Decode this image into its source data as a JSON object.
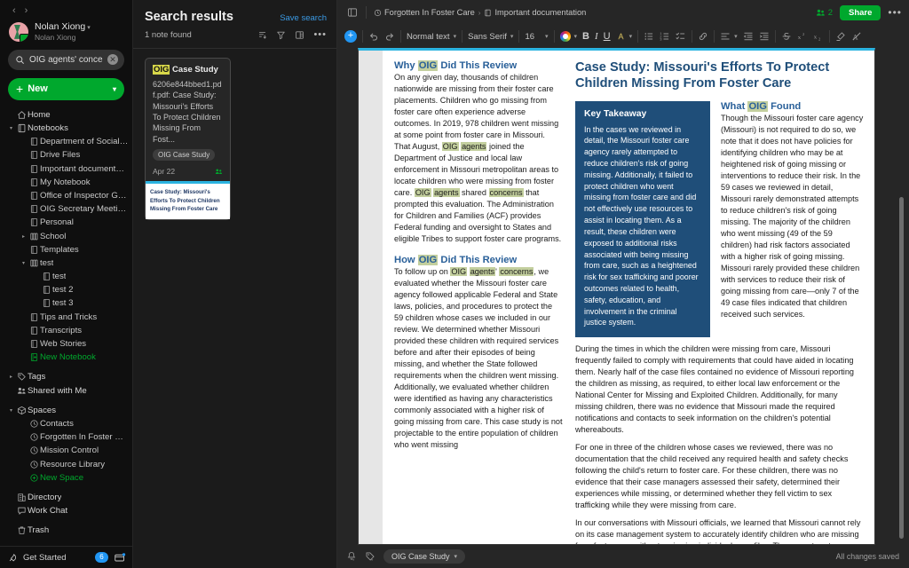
{
  "sidebar": {
    "nav_back": "‹",
    "nav_forward": "›",
    "account": {
      "name": "Nolan Xiong",
      "subname": "Nolan Xiong"
    },
    "search": {
      "value": "OIG agents' concerns",
      "placeholder": "Search"
    },
    "new_button": "New",
    "items": [
      {
        "label": "Home",
        "icon": "home-icon",
        "level": 0,
        "twisty": "",
        "green": false
      },
      {
        "label": "Notebooks",
        "icon": "notebook-icon",
        "level": 0,
        "twisty": "▾",
        "green": false
      },
      {
        "label": "Department of Social Se...",
        "icon": "note-icon",
        "level": 1,
        "twisty": "",
        "green": false
      },
      {
        "label": "Drive Files",
        "icon": "note-icon",
        "level": 1,
        "twisty": "",
        "green": false
      },
      {
        "label": "Important documentation",
        "icon": "note-icon",
        "level": 1,
        "twisty": "",
        "green": false
      },
      {
        "label": "My Notebook",
        "icon": "note-icon",
        "level": 1,
        "twisty": "",
        "green": false
      },
      {
        "label": "Office of Inspector Gene...",
        "icon": "note-icon",
        "level": 1,
        "twisty": "",
        "green": false
      },
      {
        "label": "OIG Secretary Meeting 4...",
        "icon": "note-icon",
        "level": 1,
        "twisty": "",
        "green": false
      },
      {
        "label": "Personal",
        "icon": "note-icon",
        "level": 1,
        "twisty": "",
        "green": false
      },
      {
        "label": "School",
        "icon": "stack-icon",
        "level": 1,
        "twisty": "▸",
        "green": false
      },
      {
        "label": "Templates",
        "icon": "note-icon",
        "level": 1,
        "twisty": "",
        "green": false
      },
      {
        "label": "test",
        "icon": "stack-icon",
        "level": 1,
        "twisty": "▾",
        "green": false
      },
      {
        "label": "test",
        "icon": "note-icon",
        "level": 2,
        "twisty": "",
        "green": false
      },
      {
        "label": "test 2",
        "icon": "note-icon",
        "level": 2,
        "twisty": "",
        "green": false
      },
      {
        "label": "test 3",
        "icon": "note-icon",
        "level": 2,
        "twisty": "",
        "green": false
      },
      {
        "label": "Tips and Tricks",
        "icon": "note-icon",
        "level": 1,
        "twisty": "",
        "green": false
      },
      {
        "label": "Transcripts",
        "icon": "note-icon",
        "level": 1,
        "twisty": "",
        "green": false
      },
      {
        "label": "Web Stories",
        "icon": "note-icon",
        "level": 1,
        "twisty": "",
        "green": false
      },
      {
        "label": "New Notebook",
        "icon": "new-notebook-icon",
        "level": 1,
        "twisty": "",
        "green": true
      },
      {
        "label": "",
        "icon": "spacer",
        "level": 0,
        "twisty": "",
        "green": false
      },
      {
        "label": "Tags",
        "icon": "tag-icon",
        "level": 0,
        "twisty": "▸",
        "green": false
      },
      {
        "label": "Shared with Me",
        "icon": "shared-icon",
        "level": 0,
        "twisty": "",
        "green": false
      },
      {
        "label": "",
        "icon": "spacer",
        "level": 0,
        "twisty": "",
        "green": false
      },
      {
        "label": "Spaces",
        "icon": "spaces-icon",
        "level": 0,
        "twisty": "▾",
        "green": false
      },
      {
        "label": "Contacts",
        "icon": "space-icon",
        "level": 1,
        "twisty": "",
        "green": false
      },
      {
        "label": "Forgotten In Foster Care",
        "icon": "space-icon",
        "level": 1,
        "twisty": "",
        "green": false
      },
      {
        "label": "Mission Control",
        "icon": "space-icon",
        "level": 1,
        "twisty": "",
        "green": false
      },
      {
        "label": "Resource Library",
        "icon": "space-icon",
        "level": 1,
        "twisty": "",
        "green": false
      },
      {
        "label": "New Space",
        "icon": "new-space-icon",
        "level": 1,
        "twisty": "",
        "green": true
      },
      {
        "label": "",
        "icon": "spacer",
        "level": 0,
        "twisty": "",
        "green": false
      },
      {
        "label": "Directory",
        "icon": "directory-icon",
        "level": 0,
        "twisty": "",
        "green": false
      },
      {
        "label": "Work Chat",
        "icon": "chat-icon",
        "level": 0,
        "twisty": "",
        "green": false
      },
      {
        "label": "",
        "icon": "spacer",
        "level": 0,
        "twisty": "",
        "green": false
      },
      {
        "label": "Trash",
        "icon": "trash-icon",
        "level": 0,
        "twisty": "",
        "green": false
      }
    ],
    "footer": {
      "get_started": "Get Started",
      "badge_count": "6"
    }
  },
  "results": {
    "title": "Search results",
    "save_search": "Save search",
    "count_text": "1 note found",
    "note": {
      "title_highlight": "OIG",
      "title_rest": " Case Study",
      "snippet": "6206e844bbed1.pdf.pdf: Case Study: Missouri's Efforts To Protect Children Missing From Fost...",
      "tag": "OIG Case Study",
      "date": "Apr 22",
      "thumb_text": "Case Study: Missouri's Efforts To Protect Children Missing From Foster Care"
    }
  },
  "topbar": {
    "breadcrumb_space": "Forgotten In Foster Care",
    "breadcrumb_sep": "›",
    "breadcrumb_note": "Important documentation",
    "collaborator_count": "2",
    "share_label": "Share",
    "more_label": "•••"
  },
  "formatbar": {
    "add_label": "+",
    "paragraph_style": "Normal text",
    "font_family": "Sans Serif",
    "font_size": "16"
  },
  "document": {
    "title": "Case Study: Missouri's Efforts To Protect Children Missing From Foster Care",
    "why_heading_pre": "Why ",
    "why_heading_hl": "OIG",
    "why_heading_post": " Did This Review",
    "why_body_1": "On any given day, thousands of children nationwide are missing from their foster care placements.  Children who go missing from foster care often experience adverse outcomes.  In 2019, 978 children went missing at some point from foster care in Missouri.  That August, ",
    "why_hl_1": "OIG",
    "why_body_2": " ",
    "why_hl_2": "agents",
    "why_body_3": " joined the Department of Justice and local law enforcement in Missouri metropolitan areas to locate children who were missing from foster care.  ",
    "why_hl_3": "OIG",
    "why_body_4": " ",
    "why_hl_4": "agents",
    "why_body_5": " shared ",
    "why_hl_5": "concerns",
    "why_body_6": " that prompted this evaluation.  The Administration for Children and Families (ACF) provides Federal funding and oversight to States and eligible Tribes to support foster care programs.",
    "how_heading_pre": "How ",
    "how_heading_hl": "OIG",
    "how_heading_post": " Did This Review",
    "how_body_1": "To follow up on ",
    "how_hl_1": "OIG",
    "how_body_2": " ",
    "how_hl_2": "agents",
    "how_body_3": "' ",
    "how_hl_3": "concerns",
    "how_body_4": ", we evaluated whether the Missouri foster care agency followed applicable Federal and State laws, policies, and procedures to protect the 59 children whose cases we included in our review.  We determined whether Missouri provided these children with required services before and after their episodes of being missing, and whether the State followed requirements when the children went missing.  Additionally, we evaluated whether children were identified as having any characteristics commonly associated with a higher risk of going missing from care.  This case study is not projectable to the entire population of children who went missing",
    "key_takeaway_heading": "Key Takeaway",
    "key_takeaway_body": "In the cases we reviewed in detail, the Missouri foster care agency rarely attempted to reduce children's risk of going missing.  Additionally, it failed to protect children who went missing from foster care and did not effectively use resources to assist in locating them.  As a result, these children were exposed to additional risks associated with being missing from care, such as a heightened risk for sex trafficking and poorer outcomes related to health, safety, education, and involvement in the criminal justice system.",
    "found_heading_pre": "What ",
    "found_heading_hl": "OIG",
    "found_heading_post": " Found",
    "found_body_1": "Though the Missouri foster care agency (Missouri) is not required to do so, we note that it does not have policies for identifying children who may be at heightened risk of going missing or interventions to reduce their risk.  In the 59 cases we reviewed in detail, Missouri rarely demonstrated attempts to reduce children's risk of going missing.  The majority of the children who went missing (49 of the 59 children) had risk factors associated with a higher risk of going missing.  Missouri rarely provided these children with services to reduce their risk of going missing from care—only 7 of the 49 case files indicated that children received such services.",
    "found_body_2": "During the times in which the children were missing from care, Missouri frequently failed to comply with requirements that could have aided in locating them.  Nearly half of the case files contained no evidence of Missouri reporting the children as missing, as required, to either local law enforcement or the National Center for Missing and Exploited Children.  Additionally, for many missing children, there was no evidence that Missouri made the required notifications and contacts to seek information on the children's potential whereabouts.",
    "found_body_3": "For one in three of the children whose cases we reviewed, there was no documentation that the child received any required health and safety checks following the child's return to foster care.  For these children, there was no evidence that their case managers assessed their safety, determined their experiences while missing, or determined whether they fell victim to sex trafficking while they were missing from care.",
    "found_body_4": "In our conversations with Missouri officials, we learned that Missouri cannot rely on its case management system to accurately identify children who are missing from foster care without reviewing individual case files.  The current system alone cannot distinguish between children who are missing from their"
  },
  "bottombar": {
    "notebook_chip": "OIG Case Study",
    "status": "All changes saved"
  },
  "colors": {
    "accent_green": "#00a82d",
    "link_blue": "#3b9ae4",
    "doc_heading_blue": "#2a6099",
    "doc_title_blue": "#1f4e79",
    "takeaway_bg": "#1f4e79",
    "highlight_yellow": "#d8d84a",
    "highlight_green": "#c3cf9e",
    "page_top_accent": "#2bb3e0"
  }
}
